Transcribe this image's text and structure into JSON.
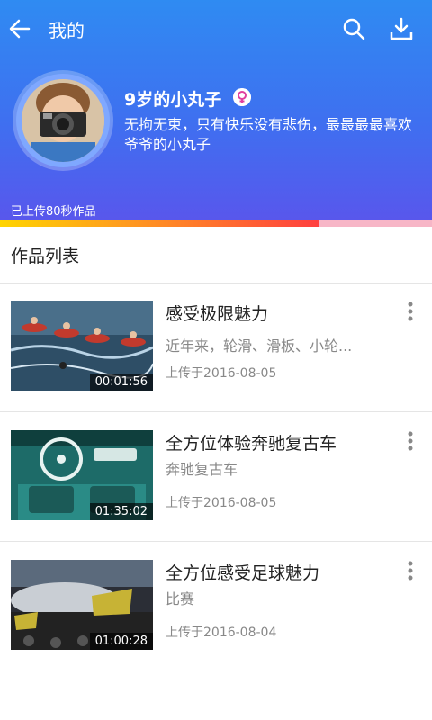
{
  "header": {
    "title": "我的",
    "back_icon": "back-arrow-icon",
    "search_icon": "search-icon",
    "download_icon": "download-icon"
  },
  "profile": {
    "name": "9岁的小丸子",
    "gender_icon": "female-icon",
    "bio": "无拘无束，只有快乐没有悲伤，最最最最喜欢爷爷的小丸子",
    "uploaded_text": "已上传80秒作品",
    "progress": 0.74
  },
  "section": {
    "title": "作品列表"
  },
  "works": [
    {
      "title": "感受极限魅力",
      "desc": "近年来，轮滑、滑板、小轮...",
      "date": "上传于2016-08-05",
      "duration": "00:01:56"
    },
    {
      "title": "全方位体验奔驰复古车",
      "desc": "奔驰复古车",
      "date": "上传于2016-08-05",
      "duration": "01:35:02"
    },
    {
      "title": "全方位感受足球魅力",
      "desc": "比赛",
      "date": "上传于2016-08-04",
      "duration": "01:00:28"
    }
  ],
  "colors": {
    "header_top": "#2f8bf2",
    "header_bottom": "#5a55ec",
    "progress_track": "#f7b6c7",
    "female": "#e040a0"
  }
}
